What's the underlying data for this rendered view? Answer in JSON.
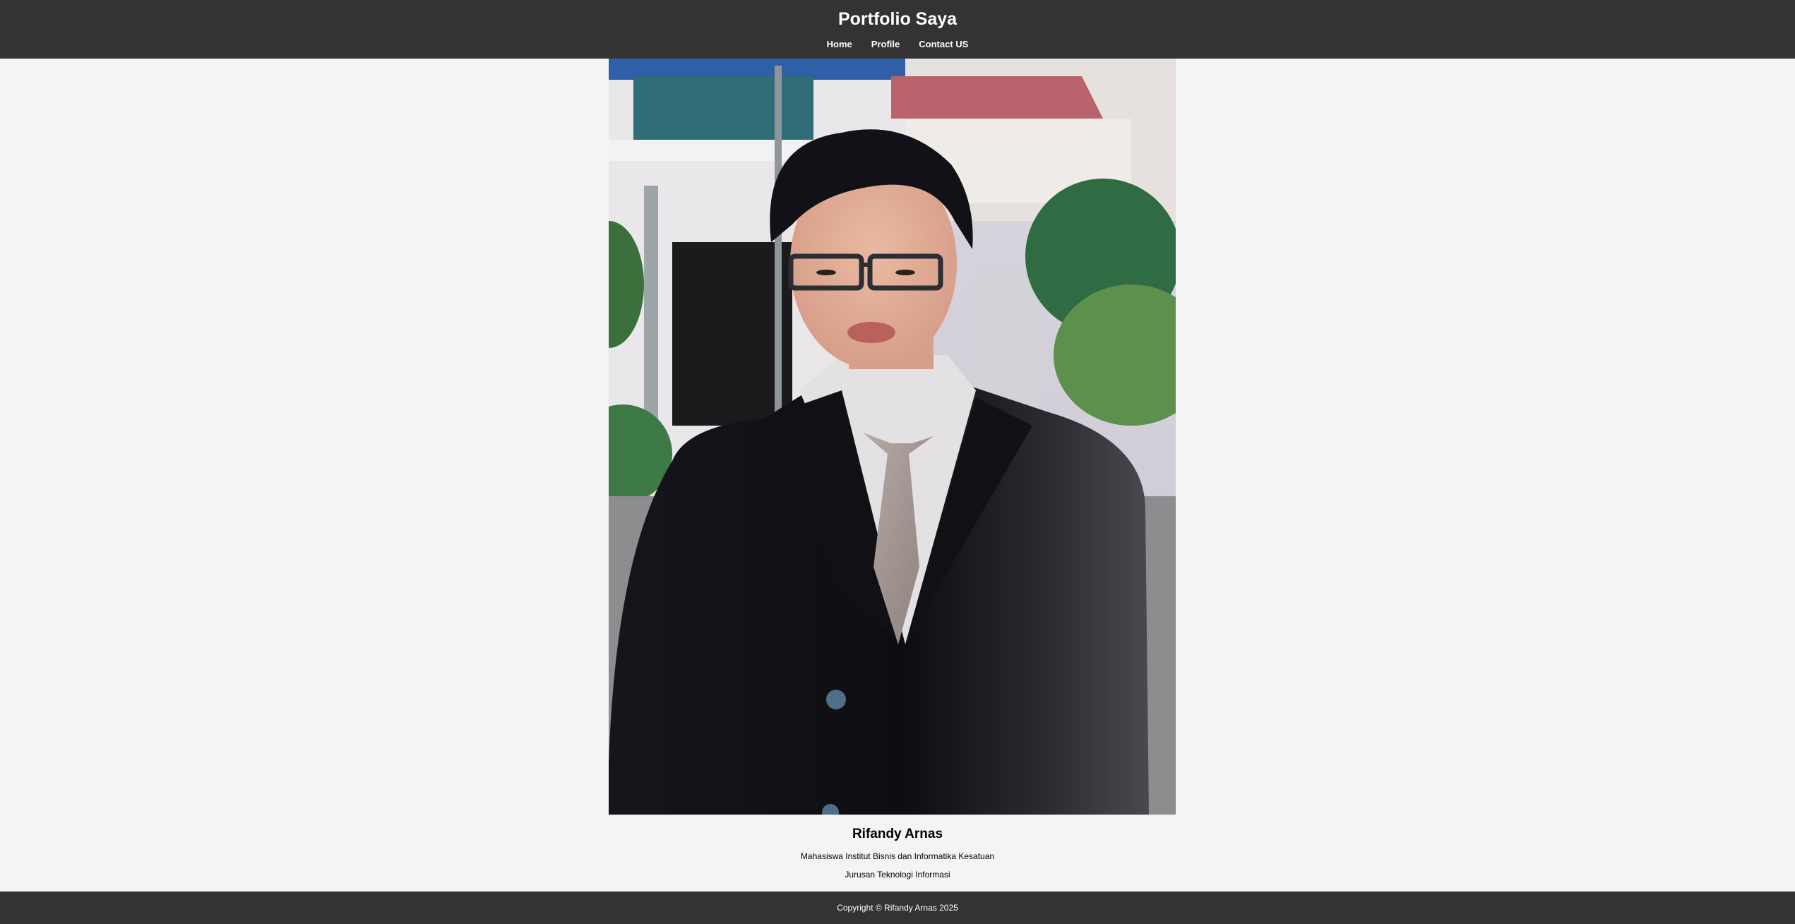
{
  "header": {
    "title": "Portfolio Saya",
    "nav": [
      {
        "label": "Home"
      },
      {
        "label": "Profile"
      },
      {
        "label": "Contact US"
      }
    ]
  },
  "profile": {
    "photo_alt": "Rifandy Arnas",
    "name": "Rifandy Arnas",
    "description_line1": "Mahasiswa Institut Bisnis dan Informatika Kesatuan",
    "description_line2": "Jurusan Teknologi Informasi"
  },
  "footer": {
    "copyright": "Copyright © Rifandy Arnas 2025"
  },
  "colors": {
    "header_bg": "#333333",
    "page_bg": "#f4f4f4",
    "footer_bg": "#333333",
    "text_light": "#ffffff"
  }
}
